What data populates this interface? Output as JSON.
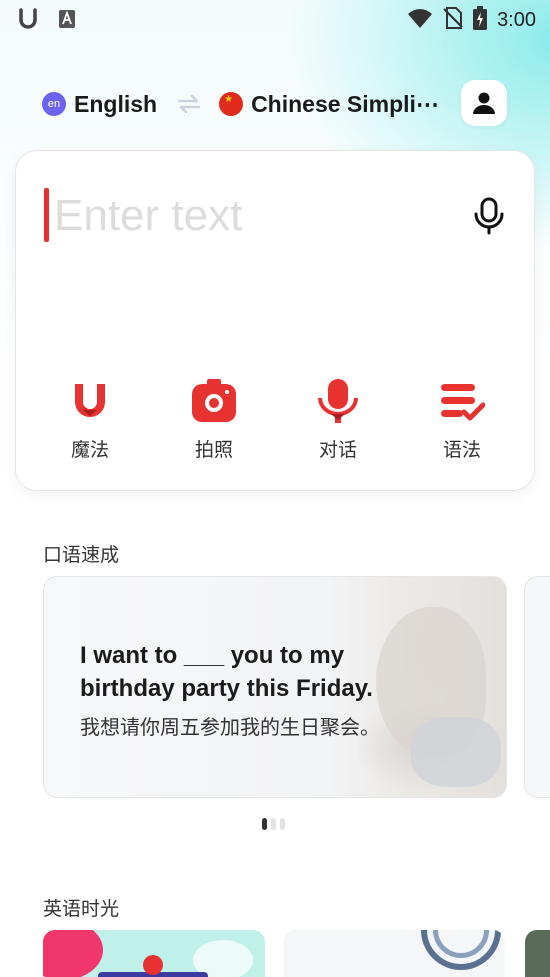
{
  "status_bar": {
    "time": "3:00",
    "left_icons": [
      "app-u-icon",
      "font-a-icon"
    ],
    "right_icons": [
      "wifi-icon",
      "no-sim-icon",
      "battery-charging-icon"
    ]
  },
  "language_bar": {
    "source_badge": "en",
    "source_language": "English",
    "target_language": "Chinese Simpli⋯"
  },
  "input": {
    "placeholder": "Enter text",
    "value": ""
  },
  "tools": [
    {
      "label": "魔法",
      "icon": "magic-u-icon"
    },
    {
      "label": "拍照",
      "icon": "camera-icon"
    },
    {
      "label": "对话",
      "icon": "conversation-mic-icon"
    },
    {
      "label": "语法",
      "icon": "grammar-check-icon"
    }
  ],
  "sections": {
    "speaking": {
      "title": "口语速成",
      "card": {
        "english": "I want to ___ you to my birthday party this Friday.",
        "chinese": "我想请你周五参加我的生日聚会。"
      },
      "pager": {
        "count": 3,
        "active": 1
      }
    },
    "english_time": {
      "title": "英语时光"
    }
  },
  "colors": {
    "accent_red": "#e8322f",
    "badge_purple": "#6b64f0",
    "glow_cyan": "#78e8e8"
  }
}
